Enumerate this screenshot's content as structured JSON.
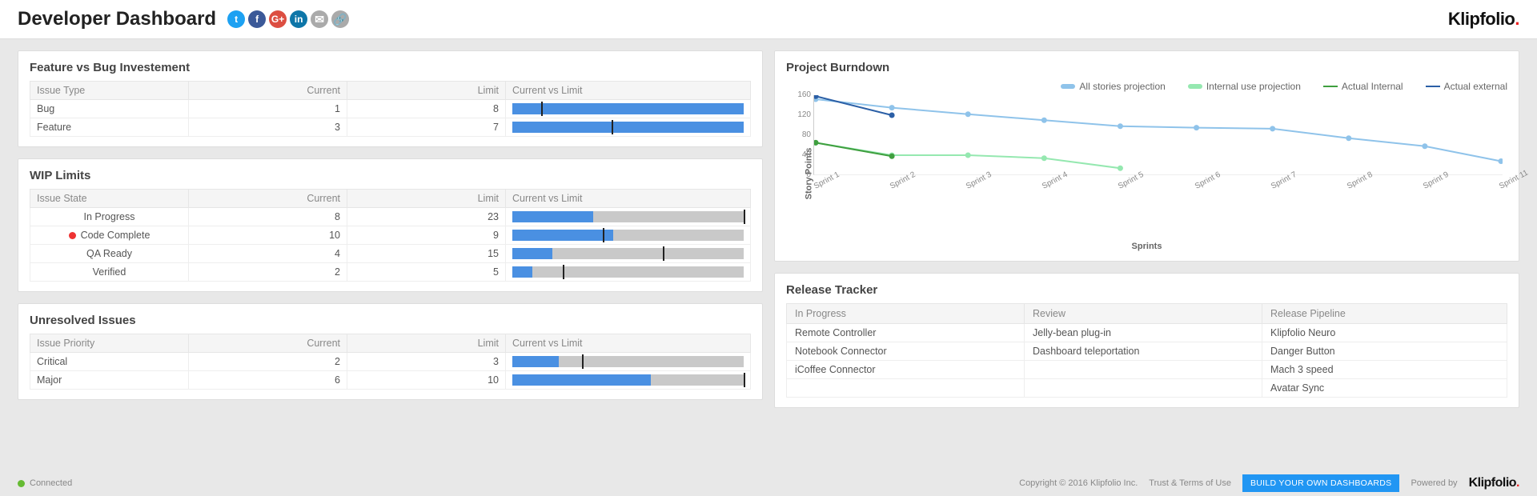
{
  "header": {
    "title": "Developer Dashboard",
    "brand": "Klipfolio"
  },
  "social": {
    "twitter": "t",
    "facebook": "f",
    "googleplus": "G+",
    "linkedin": "in",
    "mail": "✉",
    "link": "🔗"
  },
  "feature_bug": {
    "title": "Feature vs Bug Investement",
    "headers": {
      "type": "Issue Type",
      "current": "Current",
      "limit": "Limit",
      "cvl": "Current vs Limit"
    },
    "rows": [
      {
        "type": "Bug",
        "current": 1,
        "limit": 8
      },
      {
        "type": "Feature",
        "current": 3,
        "limit": 7
      }
    ]
  },
  "wip": {
    "title": "WIP Limits",
    "headers": {
      "state": "Issue State",
      "current": "Current",
      "limit": "Limit",
      "cvl": "Current vs Limit"
    },
    "rows": [
      {
        "state": "In Progress",
        "current": 8,
        "limit": 23,
        "alert": false
      },
      {
        "state": "Code Complete",
        "current": 10,
        "limit": 9,
        "alert": true
      },
      {
        "state": "QA Ready",
        "current": 4,
        "limit": 15,
        "alert": false
      },
      {
        "state": "Verified",
        "current": 2,
        "limit": 5,
        "alert": false
      }
    ]
  },
  "unresolved": {
    "title": "Unresolved Issues",
    "headers": {
      "prio": "Issue Priority",
      "current": "Current",
      "limit": "Limit",
      "cvl": "Current vs Limit"
    },
    "rows": [
      {
        "prio": "Critical",
        "current": 2,
        "limit": 3
      },
      {
        "prio": "Major",
        "current": 6,
        "limit": 10
      }
    ]
  },
  "burndown": {
    "title": "Project Burndown",
    "ylabel": "Story Points",
    "xlabel": "Sprints",
    "legend": {
      "all": "All stories projection",
      "int_proj": "Internal use projection",
      "act_int": "Actual Internal",
      "act_ext": "Actual external"
    }
  },
  "release": {
    "title": "Release Tracker",
    "headers": {
      "inprog": "In Progress",
      "review": "Review",
      "pipe": "Release Pipeline"
    },
    "cols": {
      "inprog": [
        "Remote Controller",
        "Notebook Connector",
        "iCoffee Connector"
      ],
      "review": [
        "Jelly-bean plug-in",
        "Dashboard teleportation"
      ],
      "pipe": [
        "Klipfolio Neuro",
        "Danger Button",
        "Mach 3 speed",
        "Avatar Sync"
      ]
    }
  },
  "footer": {
    "connected": "Connected",
    "copyright": "Copyright © 2016 Klipfolio Inc.",
    "trust": "Trust & Terms of Use",
    "build": "BUILD YOUR OWN DASHBOARDS",
    "powered": "Powered by"
  },
  "chart_data": {
    "type": "line",
    "xlabel": "Sprints",
    "ylabel": "Story Points",
    "ylim": [
      0,
      160
    ],
    "yticks": [
      0,
      40,
      80,
      120,
      160
    ],
    "categories": [
      "Sprint 1",
      "Sprint 2",
      "Sprint 3",
      "Sprint 4",
      "Sprint 5",
      "Sprint 6",
      "Sprint 7",
      "Sprint 8",
      "Sprint 9",
      "Sprint 11"
    ],
    "series": [
      {
        "name": "All stories projection",
        "color": "#8fc3ea",
        "values": [
          152,
          135,
          122,
          110,
          98,
          95,
          93,
          74,
          58,
          28
        ]
      },
      {
        "name": "Internal use projection",
        "color": "#95e8b0",
        "values": [
          65,
          40,
          40,
          34,
          14,
          null,
          null,
          null,
          null,
          null
        ]
      },
      {
        "name": "Actual Internal",
        "color": "#3f9f3f",
        "values": [
          65,
          38,
          null,
          null,
          null,
          null,
          null,
          null,
          null,
          null
        ]
      },
      {
        "name": "Actual external",
        "color": "#2b5fa6",
        "values": [
          158,
          120,
          null,
          null,
          null,
          null,
          null,
          null,
          null,
          null
        ]
      }
    ]
  }
}
